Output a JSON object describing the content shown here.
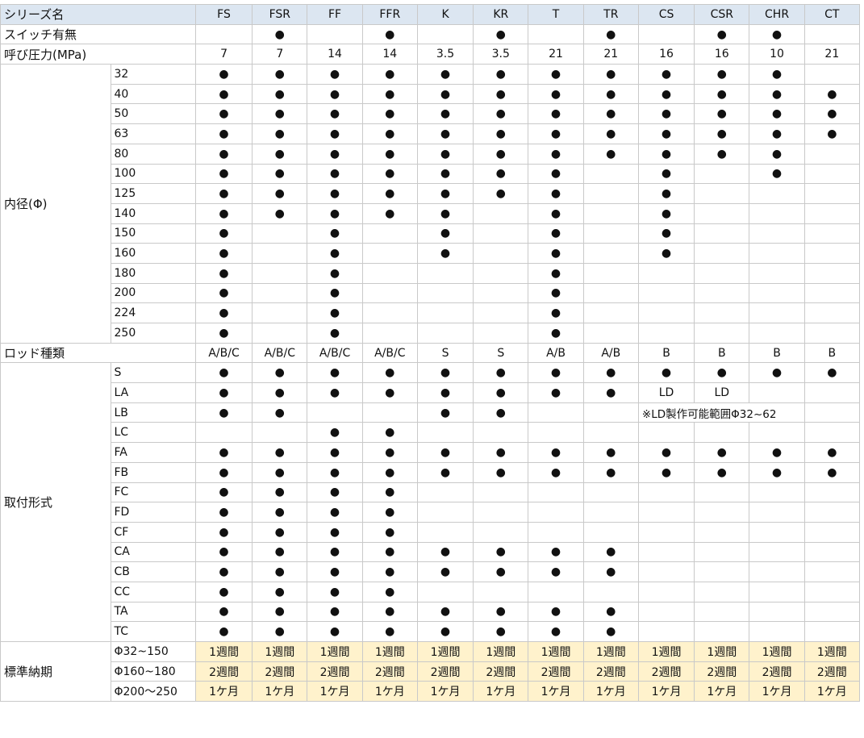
{
  "header_label": "シリーズ名",
  "series": [
    "FS",
    "FSR",
    "FF",
    "FFR",
    "K",
    "KR",
    "T",
    "TR",
    "CS",
    "CSR",
    "CHR",
    "CT"
  ],
  "switch": {
    "label": "スイッチ有無",
    "values": [
      "",
      "●",
      "",
      "●",
      "",
      "●",
      "",
      "●",
      "",
      "●",
      "●",
      ""
    ]
  },
  "pressure": {
    "label": "呼び圧力(MPa)",
    "values": [
      "7",
      "7",
      "14",
      "14",
      "3.5",
      "3.5",
      "21",
      "21",
      "16",
      "16",
      "10",
      "21"
    ]
  },
  "bore": {
    "label": "内径(Φ)",
    "rows": [
      {
        "sub": "32",
        "values": [
          "●",
          "●",
          "●",
          "●",
          "●",
          "●",
          "●",
          "●",
          "●",
          "●",
          "●",
          ""
        ]
      },
      {
        "sub": "40",
        "values": [
          "●",
          "●",
          "●",
          "●",
          "●",
          "●",
          "●",
          "●",
          "●",
          "●",
          "●",
          "●"
        ]
      },
      {
        "sub": "50",
        "values": [
          "●",
          "●",
          "●",
          "●",
          "●",
          "●",
          "●",
          "●",
          "●",
          "●",
          "●",
          "●"
        ]
      },
      {
        "sub": "63",
        "values": [
          "●",
          "●",
          "●",
          "●",
          "●",
          "●",
          "●",
          "●",
          "●",
          "●",
          "●",
          "●"
        ]
      },
      {
        "sub": "80",
        "values": [
          "●",
          "●",
          "●",
          "●",
          "●",
          "●",
          "●",
          "●",
          "●",
          "●",
          "●",
          ""
        ]
      },
      {
        "sub": "100",
        "values": [
          "●",
          "●",
          "●",
          "●",
          "●",
          "●",
          "●",
          "",
          "●",
          "",
          "●",
          ""
        ]
      },
      {
        "sub": "125",
        "values": [
          "●",
          "●",
          "●",
          "●",
          "●",
          "●",
          "●",
          "",
          "●",
          "",
          "",
          ""
        ]
      },
      {
        "sub": "140",
        "values": [
          "●",
          "●",
          "●",
          "●",
          "●",
          "",
          "●",
          "",
          "●",
          "",
          "",
          ""
        ]
      },
      {
        "sub": "150",
        "values": [
          "●",
          "",
          "●",
          "",
          "●",
          "",
          "●",
          "",
          "●",
          "",
          "",
          ""
        ]
      },
      {
        "sub": "160",
        "values": [
          "●",
          "",
          "●",
          "",
          "●",
          "",
          "●",
          "",
          "●",
          "",
          "",
          ""
        ]
      },
      {
        "sub": "180",
        "values": [
          "●",
          "",
          "●",
          "",
          "",
          "",
          "●",
          "",
          "",
          "",
          "",
          ""
        ]
      },
      {
        "sub": "200",
        "values": [
          "●",
          "",
          "●",
          "",
          "",
          "",
          "●",
          "",
          "",
          "",
          "",
          ""
        ]
      },
      {
        "sub": "224",
        "values": [
          "●",
          "",
          "●",
          "",
          "",
          "",
          "●",
          "",
          "",
          "",
          "",
          ""
        ]
      },
      {
        "sub": "250",
        "values": [
          "●",
          "",
          "●",
          "",
          "",
          "",
          "●",
          "",
          "",
          "",
          "",
          ""
        ]
      }
    ]
  },
  "rod": {
    "label": "ロッド種類",
    "values": [
      "A/B/C",
      "A/B/C",
      "A/B/C",
      "A/B/C",
      "S",
      "S",
      "A/B",
      "A/B",
      "B",
      "B",
      "B",
      "B"
    ]
  },
  "mount": {
    "label": "取付形式",
    "note": "※LD製作可能範囲Φ32~62",
    "rows": [
      {
        "sub": "S",
        "values": [
          "●",
          "●",
          "●",
          "●",
          "●",
          "●",
          "●",
          "●",
          "●",
          "●",
          "●",
          "●"
        ]
      },
      {
        "sub": "LA",
        "values": [
          "●",
          "●",
          "●",
          "●",
          "●",
          "●",
          "●",
          "●",
          "LD",
          "LD",
          "",
          ""
        ]
      },
      {
        "sub": "LB",
        "values": [
          "●",
          "●",
          "",
          "",
          "●",
          "●",
          "",
          "",
          "",
          "",
          "",
          ""
        ]
      },
      {
        "sub": "LC",
        "values": [
          "",
          "",
          "●",
          "●",
          "",
          "",
          "",
          "",
          "",
          "",
          "",
          ""
        ]
      },
      {
        "sub": "FA",
        "values": [
          "●",
          "●",
          "●",
          "●",
          "●",
          "●",
          "●",
          "●",
          "●",
          "●",
          "●",
          "●"
        ]
      },
      {
        "sub": "FB",
        "values": [
          "●",
          "●",
          "●",
          "●",
          "●",
          "●",
          "●",
          "●",
          "●",
          "●",
          "●",
          "●"
        ]
      },
      {
        "sub": "FC",
        "values": [
          "●",
          "●",
          "●",
          "●",
          "",
          "",
          "",
          "",
          "",
          "",
          "",
          ""
        ]
      },
      {
        "sub": "FD",
        "values": [
          "●",
          "●",
          "●",
          "●",
          "",
          "",
          "",
          "",
          "",
          "",
          "",
          ""
        ]
      },
      {
        "sub": "CF",
        "values": [
          "●",
          "●",
          "●",
          "●",
          "",
          "",
          "",
          "",
          "",
          "",
          "",
          ""
        ]
      },
      {
        "sub": "CA",
        "values": [
          "●",
          "●",
          "●",
          "●",
          "●",
          "●",
          "●",
          "●",
          "",
          "",
          "",
          ""
        ]
      },
      {
        "sub": "CB",
        "values": [
          "●",
          "●",
          "●",
          "●",
          "●",
          "●",
          "●",
          "●",
          "",
          "",
          "",
          ""
        ]
      },
      {
        "sub": "CC",
        "values": [
          "●",
          "●",
          "●",
          "●",
          "",
          "",
          "",
          "",
          "",
          "",
          "",
          ""
        ]
      },
      {
        "sub": "TA",
        "values": [
          "●",
          "●",
          "●",
          "●",
          "●",
          "●",
          "●",
          "●",
          "",
          "",
          "",
          ""
        ]
      },
      {
        "sub": "TC",
        "values": [
          "●",
          "●",
          "●",
          "●",
          "●",
          "●",
          "●",
          "●",
          "",
          "",
          "",
          ""
        ]
      }
    ]
  },
  "lead_time": {
    "label": "標準納期",
    "rows": [
      {
        "sub": "Φ32~150",
        "value": "1週間"
      },
      {
        "sub": "Φ160~180",
        "value": "2週間"
      },
      {
        "sub": "Φ200～250",
        "value": "1ケ月"
      }
    ]
  },
  "colors": {
    "header_fill": "#dce6f1",
    "lead_fill": "#fff2cc",
    "grid_line": "#c9c9c9"
  }
}
